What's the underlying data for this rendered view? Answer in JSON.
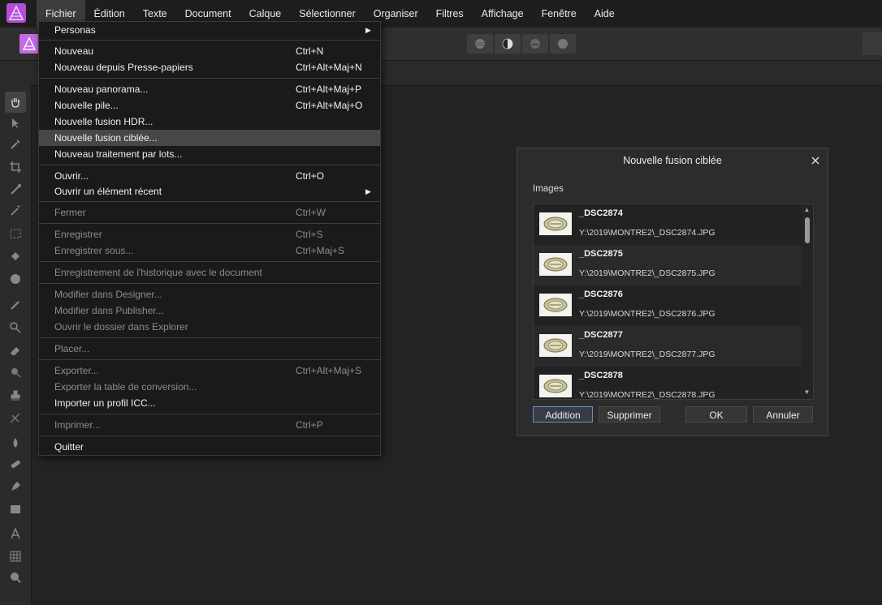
{
  "menubar": {
    "items": [
      "Fichier",
      "Édition",
      "Texte",
      "Document",
      "Calque",
      "Sélectionner",
      "Organiser",
      "Filtres",
      "Affichage",
      "Fenêtre",
      "Aide"
    ],
    "active_index": 0
  },
  "file_menu": {
    "items": [
      {
        "label": "Personas",
        "shortcut": "",
        "submenu": true,
        "disabled": false
      },
      {
        "label": "Nouveau",
        "shortcut": "Ctrl+N",
        "submenu": false,
        "disabled": false
      },
      {
        "label": "Nouveau depuis Presse-papiers",
        "shortcut": "Ctrl+Alt+Maj+N",
        "submenu": false,
        "disabled": false
      },
      {
        "label": "Nouveau panorama...",
        "shortcut": "Ctrl+Alt+Maj+P",
        "submenu": false,
        "disabled": false
      },
      {
        "label": "Nouvelle pile...",
        "shortcut": "Ctrl+Alt+Maj+O",
        "submenu": false,
        "disabled": false
      },
      {
        "label": "Nouvelle fusion HDR...",
        "shortcut": "",
        "submenu": false,
        "disabled": false
      },
      {
        "label": "Nouvelle fusion ciblée...",
        "shortcut": "",
        "submenu": false,
        "disabled": false,
        "highlighted": true
      },
      {
        "label": "Nouveau traitement par lots...",
        "shortcut": "",
        "submenu": false,
        "disabled": false
      },
      {
        "label": "Ouvrir...",
        "shortcut": "Ctrl+O",
        "submenu": false,
        "disabled": false
      },
      {
        "label": "Ouvrir un élément récent",
        "shortcut": "",
        "submenu": true,
        "disabled": false
      },
      {
        "label": "Fermer",
        "shortcut": "Ctrl+W",
        "submenu": false,
        "disabled": true
      },
      {
        "label": "Enregistrer",
        "shortcut": "Ctrl+S",
        "submenu": false,
        "disabled": true
      },
      {
        "label": "Enregistrer sous...",
        "shortcut": "Ctrl+Maj+S",
        "submenu": false,
        "disabled": true
      },
      {
        "label": "Enregistrement de l'historique avec le document",
        "shortcut": "",
        "submenu": false,
        "disabled": true
      },
      {
        "label": "Modifier dans Designer...",
        "shortcut": "",
        "submenu": false,
        "disabled": true
      },
      {
        "label": "Modifier dans Publisher...",
        "shortcut": "",
        "submenu": false,
        "disabled": true
      },
      {
        "label": "Ouvrir le dossier dans Explorer",
        "shortcut": "",
        "submenu": false,
        "disabled": true
      },
      {
        "label": "Placer...",
        "shortcut": "",
        "submenu": false,
        "disabled": true
      },
      {
        "label": "Exporter...",
        "shortcut": "Ctrl+Alt+Maj+S",
        "submenu": false,
        "disabled": true
      },
      {
        "label": "Exporter la table de conversion...",
        "shortcut": "",
        "submenu": false,
        "disabled": true
      },
      {
        "label": "Importer un profil ICC...",
        "shortcut": "",
        "submenu": false,
        "disabled": false
      },
      {
        "label": "Imprimer...",
        "shortcut": "Ctrl+P",
        "submenu": false,
        "disabled": true
      },
      {
        "label": "Quitter",
        "shortcut": "",
        "submenu": false,
        "disabled": false
      }
    ]
  },
  "dialog": {
    "title": "Nouvelle fusion ciblée",
    "images_label": "Images",
    "images": [
      {
        "name": "_DSC2874",
        "path": "Y:\\2019\\MONTRE2\\_DSC2874.JPG"
      },
      {
        "name": "_DSC2875",
        "path": "Y:\\2019\\MONTRE2\\_DSC2875.JPG"
      },
      {
        "name": "_DSC2876",
        "path": "Y:\\2019\\MONTRE2\\_DSC2876.JPG"
      },
      {
        "name": "_DSC2877",
        "path": "Y:\\2019\\MONTRE2\\_DSC2877.JPG"
      },
      {
        "name": "_DSC2878",
        "path": "Y:\\2019\\MONTRE2\\_DSC2878.JPG"
      }
    ],
    "buttons": {
      "add": "Addition",
      "remove": "Supprimer",
      "ok": "OK",
      "cancel": "Annuler"
    }
  },
  "colors": {
    "accent": "#9b3fd6",
    "menu_bg": "#1a1a1a",
    "highlight": "#474747"
  }
}
